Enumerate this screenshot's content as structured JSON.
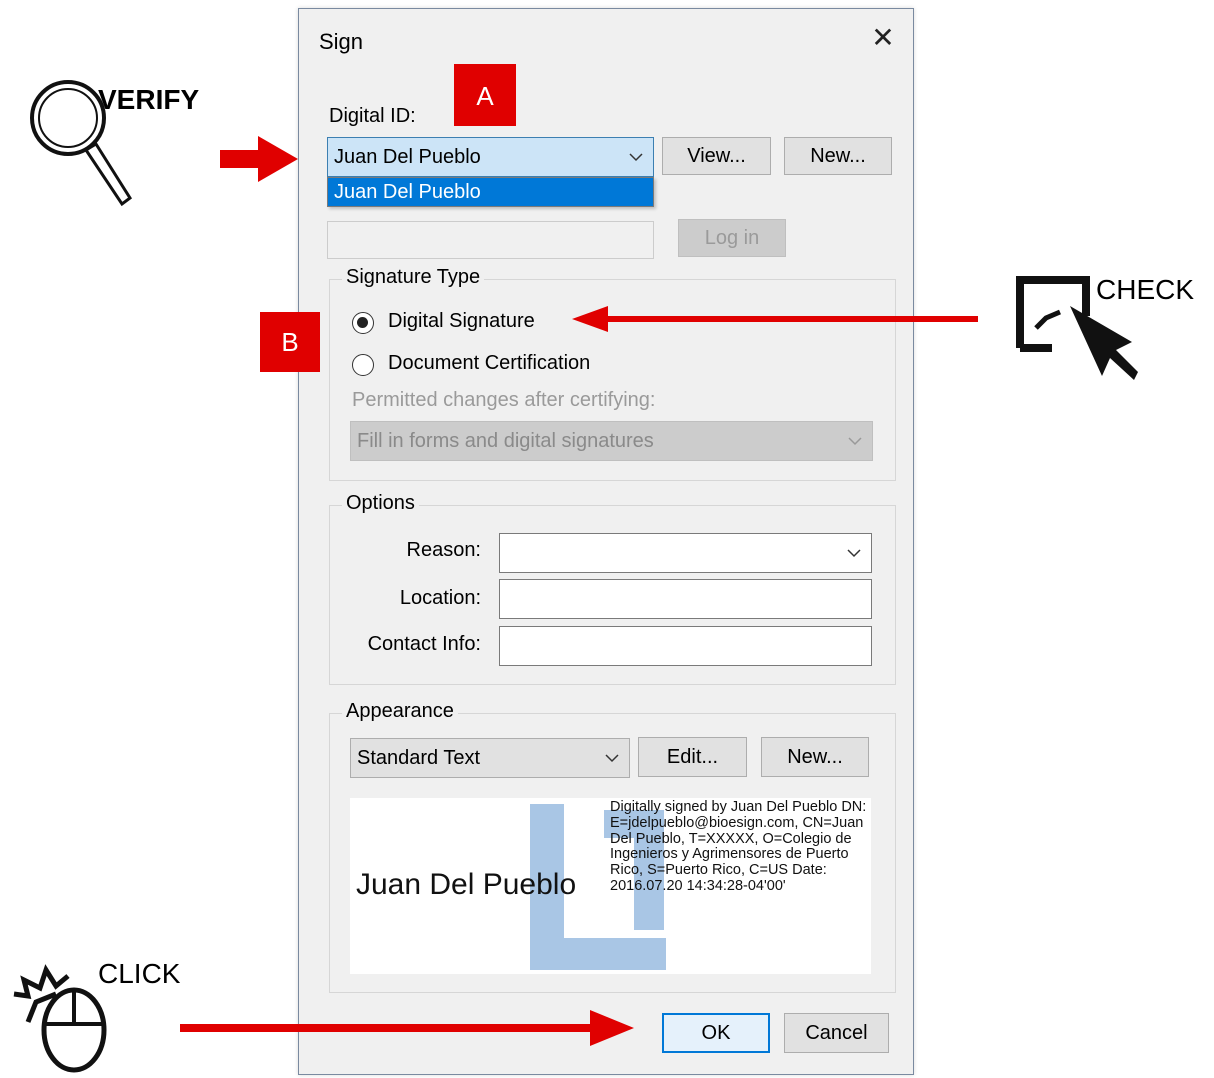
{
  "dialog": {
    "title": "Sign",
    "digital_id": {
      "label": "Digital ID:",
      "selected": "Juan Del Pueblo",
      "dropdown_option": "Juan Del Pueblo",
      "view_button": "View...",
      "new_button": "New..."
    },
    "login_button": "Log in",
    "signature_type": {
      "legend": "Signature Type",
      "digital_signature": "Digital Signature",
      "document_certification": "Document Certification",
      "permitted_label": "Permitted changes after certifying:",
      "permitted_value": "Fill in forms and digital signatures"
    },
    "options": {
      "legend": "Options",
      "reason_label": "Reason:",
      "location_label": "Location:",
      "contact_label": "Contact Info:"
    },
    "appearance": {
      "legend": "Appearance",
      "selected": "Standard Text",
      "edit_button": "Edit...",
      "new_button": "New...",
      "preview_name": "Juan Del Pueblo",
      "preview_details": "Digitally signed by Juan Del Pueblo DN: E=jdelpueblo@bioesign.com, CN=Juan Del Pueblo, T=XXXXX, O=Colegio de Ingenieros y Agrimensores de Puerto Rico, S=Puerto Rico, C=US Date: 2016.07.20 14:34:28-04'00'"
    },
    "ok_button": "OK",
    "cancel_button": "Cancel"
  },
  "annotations": {
    "marker_a": "A",
    "marker_b": "B",
    "verify_text": "VERIFY",
    "check_text": "CHECK",
    "click_text": "CLICK",
    "accent_color": "#e00000"
  }
}
